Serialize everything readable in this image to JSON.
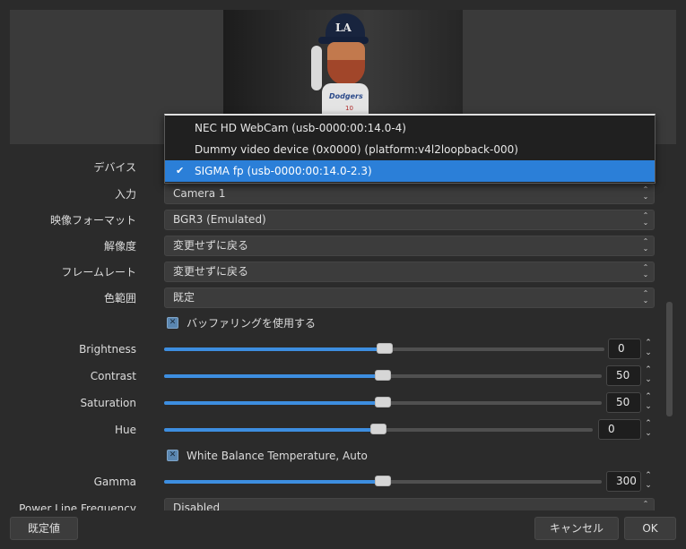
{
  "preview": {
    "cap_logo": "LA",
    "jersey_text": "Dodgers",
    "jersey_number": "10"
  },
  "properties": {
    "device_label": "デバイス",
    "input_label": "入力",
    "input_value": "Camera 1",
    "video_format_label": "映像フォーマット",
    "video_format_value": "BGR3 (Emulated)",
    "resolution_label": "解像度",
    "resolution_value": "変更せずに戻る",
    "framerate_label": "フレームレート",
    "framerate_value": "変更せずに戻る",
    "color_range_label": "色範囲",
    "color_range_value": "既定",
    "buffering_label": "バッファリングを使用する",
    "brightness_label": "Brightness",
    "brightness_value": "0",
    "contrast_label": "Contrast",
    "contrast_value": "50",
    "saturation_label": "Saturation",
    "saturation_value": "50",
    "hue_label": "Hue",
    "hue_value": "0",
    "wb_auto_label": "White Balance Temperature, Auto",
    "gamma_label": "Gamma",
    "gamma_value": "300",
    "power_line_label": "Power Line Frequency",
    "power_line_value": "Disabled"
  },
  "sliders": {
    "brightness_fraction": 0.5,
    "contrast_fraction": 0.5,
    "saturation_fraction": 0.5,
    "hue_fraction": 0.5,
    "gamma_fraction": 0.5
  },
  "device_dropdown": {
    "items": [
      {
        "label": "NEC HD WebCam (usb-0000:00:14.0-4)",
        "selected": false
      },
      {
        "label": "Dummy video device (0x0000) (platform:v4l2loopback-000)",
        "selected": false
      },
      {
        "label": "SIGMA fp (usb-0000:00:14.0-2.3)",
        "selected": true
      }
    ],
    "check_glyph": "✔"
  },
  "footer": {
    "defaults_label": "既定値",
    "cancel_label": "キャンセル",
    "ok_label": "OK"
  },
  "colors": {
    "accent": "#2b7fd8",
    "background": "#2b2b2b"
  }
}
